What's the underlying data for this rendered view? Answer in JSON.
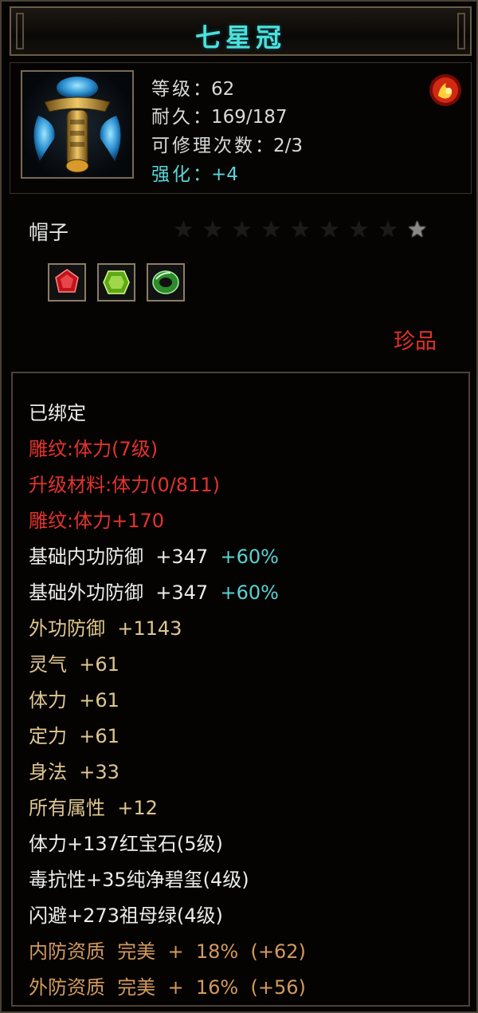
{
  "item": {
    "name": "七星冠",
    "type": "帽子",
    "rarity": "珍品",
    "stats": {
      "level": {
        "key": "等级",
        "sep": "：",
        "value": "62"
      },
      "durability": {
        "key": "耐久",
        "sep": "：",
        "value": "169/187"
      },
      "repairs": {
        "key": "可修理次数",
        "sep": "：",
        "value": "2/3"
      },
      "enhance": {
        "key": "强化",
        "sep": "：",
        "value": "+4"
      }
    },
    "stars": {
      "total": 9,
      "lit": 1
    },
    "gems": [
      "red-ruby-gem-icon",
      "green-peridot-gem-icon",
      "green-jade-ring-icon"
    ]
  },
  "attributes": [
    {
      "text": "已绑定",
      "color": "white"
    },
    {
      "text": "雕纹:体力(7级)",
      "color": "red"
    },
    {
      "text": "升级材料:体力(0/811)",
      "color": "red"
    },
    {
      "text": "雕纹:体力+170",
      "color": "red"
    },
    {
      "text": "基础内功防御  +347",
      "bonus": "+60%",
      "color": "white"
    },
    {
      "text": "基础外功防御  +347",
      "bonus": "+60%",
      "color": "white"
    },
    {
      "text": "外功防御  +1143",
      "color": "gold"
    },
    {
      "text": "灵气  +61",
      "color": "gold"
    },
    {
      "text": "体力  +61",
      "color": "gold"
    },
    {
      "text": "定力  +61",
      "color": "gold"
    },
    {
      "text": "身法  +33",
      "color": "gold"
    },
    {
      "text": "所有属性  +12",
      "color": "gold"
    },
    {
      "text": "体力+137红宝石(5级)",
      "color": "white"
    },
    {
      "text": "毒抗性+35纯净碧玺(4级)",
      "color": "white"
    },
    {
      "text": "闪避+273祖母绿(4级)",
      "color": "white"
    },
    {
      "text": "内防资质  完美  +  18%  (+62)",
      "color": "orange"
    },
    {
      "text": "外防资质  完美  +  16%  (+56)",
      "color": "orange"
    }
  ],
  "colors": {
    "title": "#4ee0d8",
    "red": "#e2332c",
    "gold": "#dfc690",
    "orange": "#d49a5a",
    "cyan": "#57d2d2",
    "white": "#ececec"
  }
}
